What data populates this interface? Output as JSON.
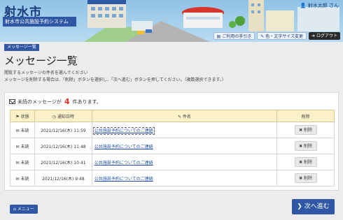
{
  "header": {
    "city_title": "射水市",
    "system_title": "射水市公共施設予約システム",
    "user_label": "射水太郎 さん",
    "buttons": {
      "guide": "ご利用の手引き",
      "color_size": "色・文字サイズ変更",
      "logout": "ログアウト"
    }
  },
  "breadcrumb_badge": "メッセージ一覧",
  "page_title": "メッセージ一覧",
  "instructions": {
    "line1": "閲覧するメッセージの件名を選んでください",
    "line2": "メッセージを削除する場合は、「削除」ボタンを選択し、「次へ進む」ボタンを押してください。（複数選択できます。）"
  },
  "unread_notice": {
    "prefix": "未読のメッセージが",
    "count": "4",
    "suffix": "件あります。"
  },
  "table": {
    "headers": {
      "status": "状態",
      "date": "通知日時",
      "subject": "件名",
      "delete": "削除"
    },
    "rows": [
      {
        "status": "未読",
        "date": "2021/12/16(木) 11:59",
        "subject": "公共施設予約についてのご連絡",
        "delete": "削除"
      },
      {
        "status": "未読",
        "date": "2021/12/16(木) 11:48",
        "subject": "公共施設予約についてのご連絡",
        "delete": "削除"
      },
      {
        "status": "未読",
        "date": "2021/12/16(木) 10:41",
        "subject": "公共施設予約についてのご連絡",
        "delete": "削除"
      },
      {
        "status": "未読",
        "date": "2021/12/16(木) 9:48",
        "subject": "公共施設予約についてのご連絡",
        "delete": "削除"
      }
    ]
  },
  "footer": {
    "menu_label": "メニュー",
    "next_label": "次へ進む"
  },
  "colors": {
    "primary": "#2f57a3",
    "header_row": "#fbf0c7",
    "count_red": "#d9342b"
  }
}
